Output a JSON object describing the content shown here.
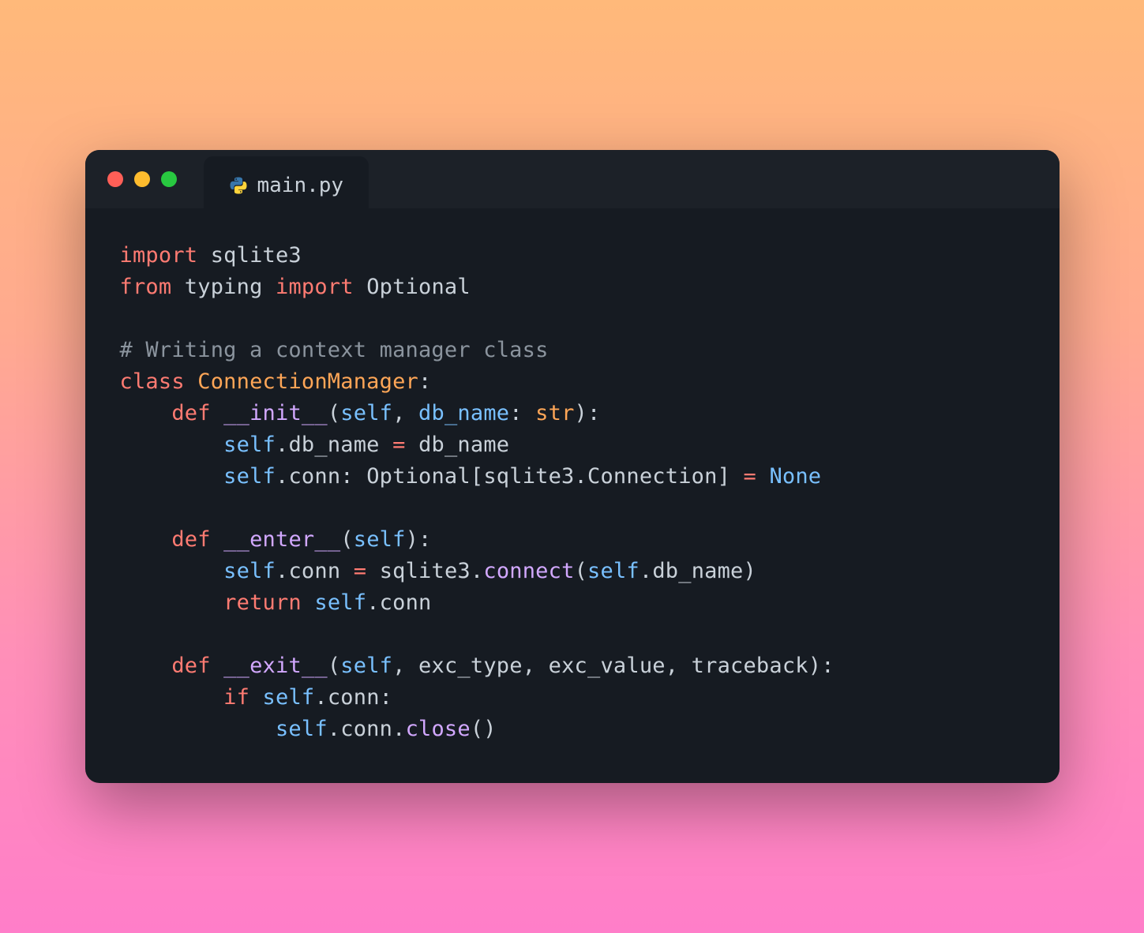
{
  "tab": {
    "filename": "main.py"
  },
  "code": {
    "tokens": {
      "kw_import": "import",
      "kw_from": "from",
      "kw_class": "class",
      "kw_def": "def",
      "kw_return": "return",
      "kw_if": "if",
      "mod_sqlite3": "sqlite3",
      "mod_typing": "typing",
      "name_optional": "Optional",
      "comment_1": "# Writing a context manager class",
      "cls_name": "ConnectionManager",
      "fn_init": "__init__",
      "fn_enter": "__enter__",
      "fn_exit": "__exit__",
      "p_self": "self",
      "p_dbname": "db_name",
      "t_str": "str",
      "attr_dbname": "db_name",
      "attr_conn": "conn",
      "t_connection": "Connection",
      "const_none": "None",
      "fn_connect": "connect",
      "fn_close": "close",
      "p_exc_type": "exc_type",
      "p_exc_value": "exc_value",
      "p_traceback": "traceback"
    }
  }
}
